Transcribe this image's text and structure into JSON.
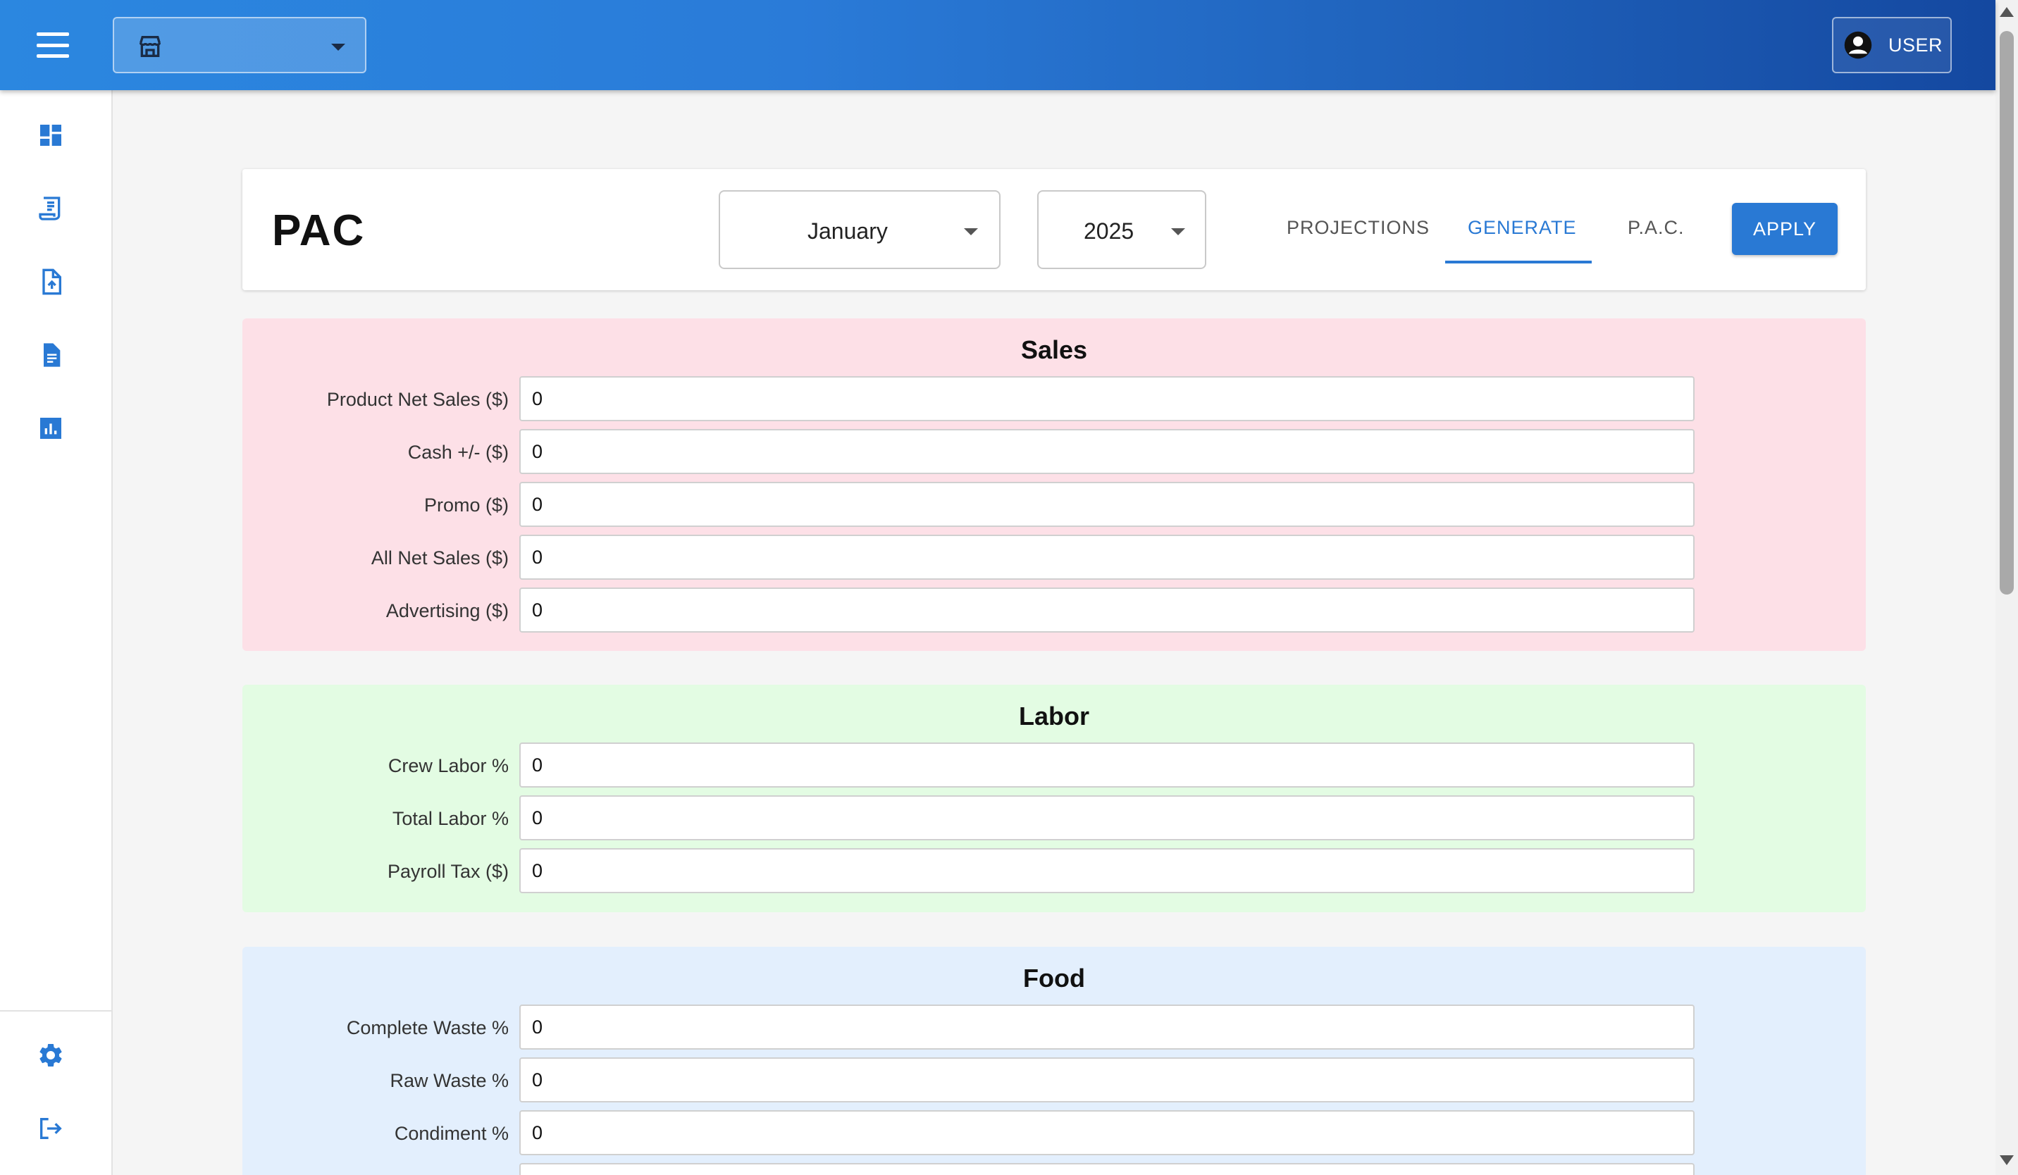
{
  "topbar": {
    "menu_icon": "hamburger-menu-icon",
    "store_selector": {
      "icon": "storefront-icon",
      "value": ""
    },
    "user": {
      "label": "USER",
      "icon": "account-circle-icon"
    }
  },
  "sidebar": {
    "items": [
      {
        "icon": "dashboard-icon"
      },
      {
        "icon": "receipt-icon"
      },
      {
        "icon": "file-upload-icon"
      },
      {
        "icon": "spreadsheet-file-icon"
      },
      {
        "icon": "bar-chart-icon"
      }
    ],
    "bottom": [
      {
        "icon": "settings-gear-icon"
      },
      {
        "icon": "logout-icon"
      }
    ]
  },
  "header": {
    "title": "PAC",
    "month": "January",
    "year": "2025",
    "tabs": [
      {
        "label": "PROJECTIONS",
        "active": false
      },
      {
        "label": "GENERATE",
        "active": true
      },
      {
        "label": "P.A.C.",
        "active": false
      }
    ],
    "apply_label": "APPLY"
  },
  "sections": {
    "sales": {
      "title": "Sales",
      "color": "#fde0e7",
      "fields": [
        {
          "label": "Product Net Sales ($)",
          "value": "0"
        },
        {
          "label": "Cash +/- ($)",
          "value": "0"
        },
        {
          "label": "Promo ($)",
          "value": "0"
        },
        {
          "label": "All Net Sales ($)",
          "value": "0"
        },
        {
          "label": "Advertising ($)",
          "value": "0"
        }
      ]
    },
    "labor": {
      "title": "Labor",
      "color": "#e3fce3",
      "fields": [
        {
          "label": "Crew Labor %",
          "value": "0"
        },
        {
          "label": "Total Labor %",
          "value": "0"
        },
        {
          "label": "Payroll Tax ($)",
          "value": "0"
        }
      ]
    },
    "food": {
      "title": "Food",
      "color": "#e3effd",
      "fields": [
        {
          "label": "Complete Waste %",
          "value": "0"
        },
        {
          "label": "Raw Waste %",
          "value": "0"
        },
        {
          "label": "Condiment %",
          "value": "0"
        }
      ]
    }
  },
  "colors": {
    "primary": "#2979d4",
    "appbar_start": "#2b87e0",
    "appbar_end": "#1448a0"
  }
}
